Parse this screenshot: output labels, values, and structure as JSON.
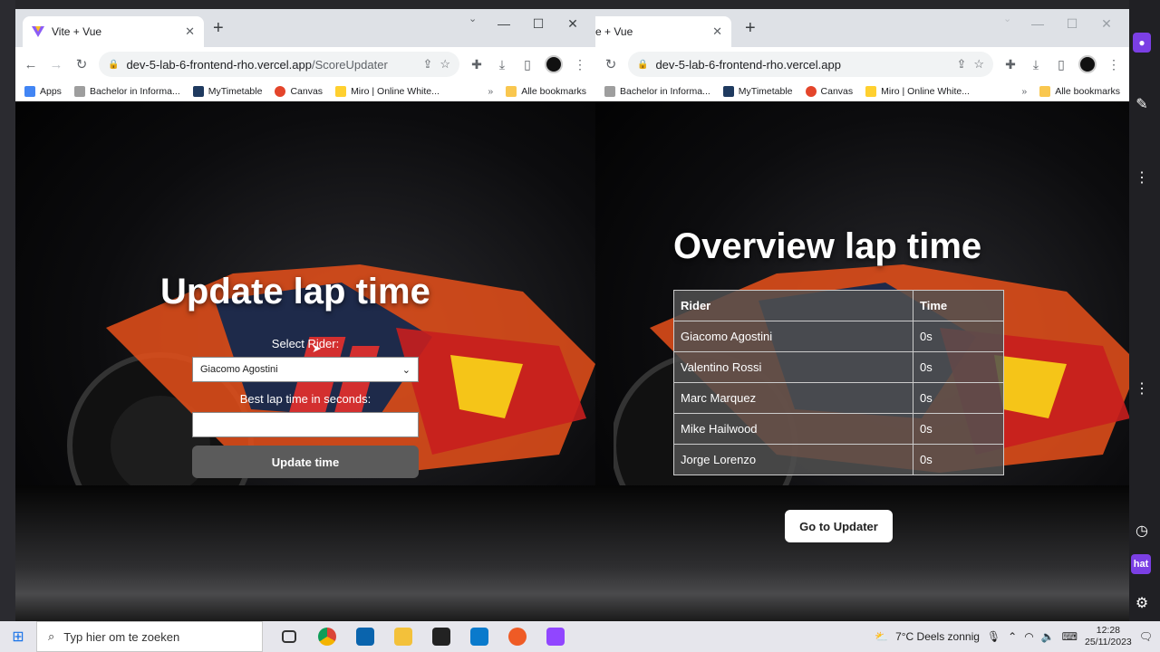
{
  "left_window": {
    "tab_title": "Vite + Vue",
    "url_host": "dev-5-lab-6-frontend-rho.vercel.app",
    "url_path": "/ScoreUpdater",
    "bookmarks": [
      "Apps",
      "Bachelor in Informa...",
      "MyTimetable",
      "Canvas",
      "Miro | Online White..."
    ],
    "all_bookmarks": "Alle bookmarks",
    "page": {
      "title": "Update lap time",
      "select_label": "Select Rider:",
      "select_value": "Giacomo Agostini",
      "time_label": "Best lap time in seconds:",
      "time_value": "",
      "button": "Update time"
    }
  },
  "right_window": {
    "tab_title": "e + Vue",
    "url_host": "dev-5-lab-6-frontend-rho.vercel.app",
    "bookmarks": [
      "Bachelor in Informa...",
      "MyTimetable",
      "Canvas",
      "Miro | Online White..."
    ],
    "all_bookmarks": "Alle bookmarks",
    "page": {
      "title": "Overview lap time",
      "columns": [
        "Rider",
        "Time"
      ],
      "rows": [
        [
          "Giacomo Agostini",
          "0s"
        ],
        [
          "Valentino Rossi",
          "0s"
        ],
        [
          "Marc Marquez",
          "0s"
        ],
        [
          "Mike Hailwood",
          "0s"
        ],
        [
          "Jorge Lorenzo",
          "0s"
        ]
      ],
      "button": "Go to Updater"
    }
  },
  "side_strip": {
    "chat_label": "hat"
  },
  "taskbar": {
    "search_placeholder": "Typ hier om te zoeken",
    "weather": "7°C  Deels zonnig",
    "time": "12:28",
    "date": "25/11/2023"
  },
  "colors": {
    "brand_orange": "#e8501a",
    "brand_red": "#c81e1e",
    "twitch_purple": "#9146ff"
  }
}
